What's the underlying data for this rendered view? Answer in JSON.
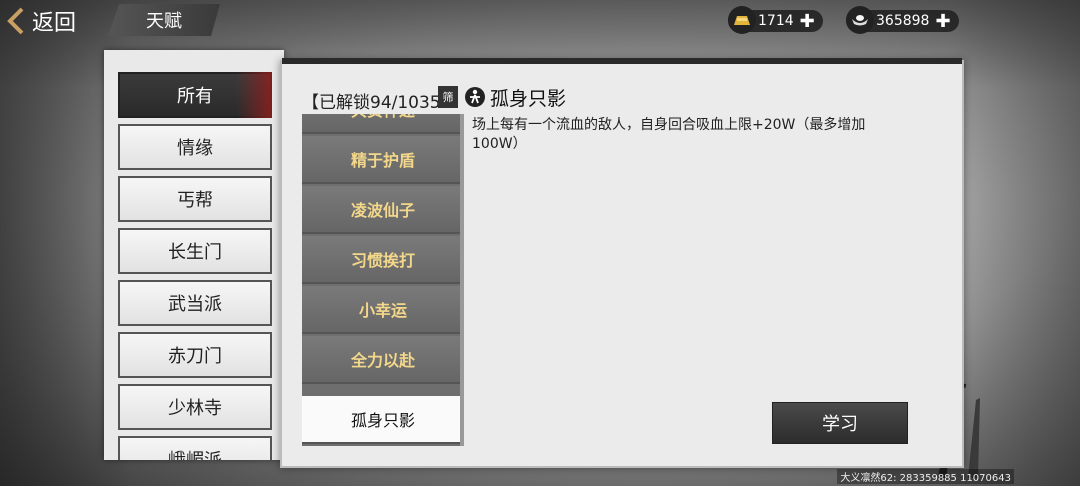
{
  "header": {
    "back_label": "返回",
    "title": "天赋"
  },
  "currency": {
    "gold": {
      "icon": "gold-ingot-icon",
      "value": "1714"
    },
    "silver": {
      "icon": "silver-ingot-icon",
      "value": "365898"
    }
  },
  "categories": [
    {
      "label": "所有",
      "active": true
    },
    {
      "label": "情缘"
    },
    {
      "label": "丐帮"
    },
    {
      "label": "长生门"
    },
    {
      "label": "武当派"
    },
    {
      "label": "赤刀门"
    },
    {
      "label": "少林寺"
    },
    {
      "label": "峨嵋派"
    }
  ],
  "main": {
    "unlock_label": "【已解锁94/1035",
    "filter_label": "筛",
    "talents": [
      "兵贵神速",
      "精于护盾",
      "凌波仙子",
      "习惯挨打",
      "小幸运",
      "全力以赴",
      "孤身只影"
    ],
    "selected_talent": "孤身只影",
    "detail_title": "孤身只影",
    "detail_desc": "场上每有一个流血的敌人，自身回合吸血上限+20W（最多增加100W）",
    "learn_label": "学习"
  },
  "footer": {
    "info": "大义凛然62: 283359885  11070643"
  }
}
